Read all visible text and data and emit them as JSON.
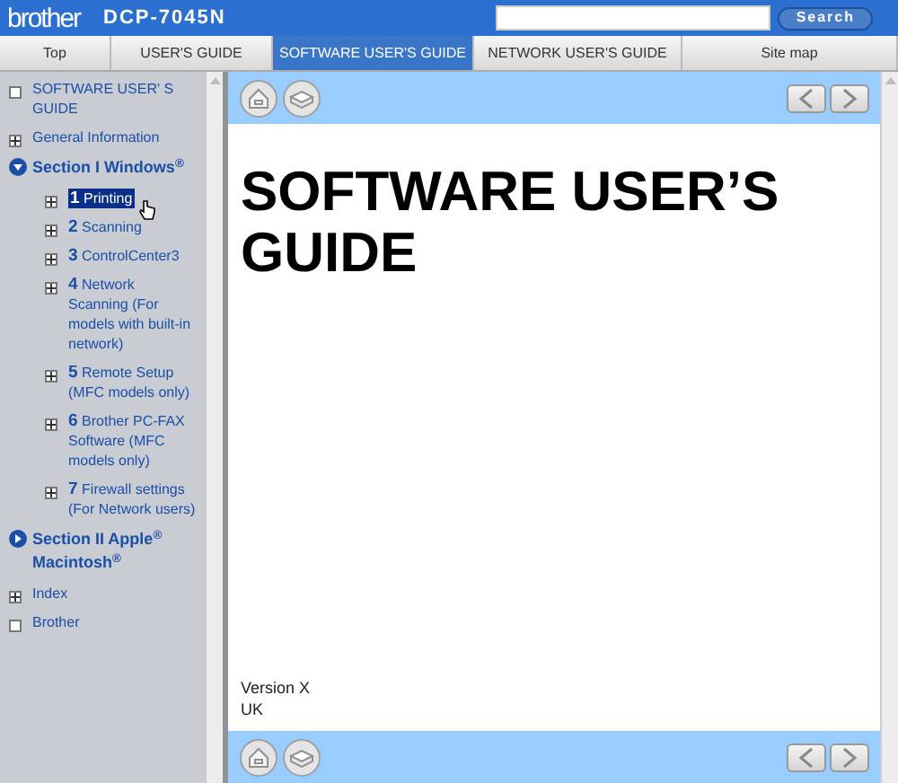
{
  "header": {
    "brand": "brother",
    "model": "DCP-7045N",
    "search_button": "Search"
  },
  "tabs": [
    {
      "label": "Top",
      "selected": false
    },
    {
      "label": "USER'S GUIDE",
      "selected": false
    },
    {
      "label": "SOFTWARE USER'S GUIDE",
      "selected": true
    },
    {
      "label": "NETWORK USER'S GUIDE",
      "selected": false
    },
    {
      "label": "Site map",
      "selected": false
    }
  ],
  "sidebar": {
    "items": [
      {
        "kind": "page",
        "label": "SOFTWARE USER' S GUIDE"
      },
      {
        "kind": "collapsed",
        "label": "General Information"
      },
      {
        "kind": "section",
        "expanded": true,
        "label": "Section I Windows$^{®}$",
        "children": [
          {
            "number": "1",
            "label": "Printing",
            "selected": true
          },
          {
            "number": "2",
            "label": "Scanning",
            "selected": false
          },
          {
            "number": "3",
            "label": "ControlCenter3",
            "selected": false
          },
          {
            "number": "4",
            "label": "Network Scanning (For models with built-in network)",
            "selected": false
          },
          {
            "number": "5",
            "label": "Remote Setup (MFC models only)",
            "selected": false
          },
          {
            "number": "6",
            "label": "Brother PC-FAX Software (MFC models only)",
            "selected": false
          },
          {
            "number": "7",
            "label": "Firewall settings (For Network users)",
            "selected": false
          }
        ]
      },
      {
        "kind": "section",
        "expanded": false,
        "label": "Section II Apple$^{®}$ Macintosh$^{®}$"
      },
      {
        "kind": "collapsed",
        "label": "Index"
      },
      {
        "kind": "page",
        "label": "Brother"
      }
    ]
  },
  "content": {
    "title": "SOFTWARE USER’S GUIDE",
    "footer_lines": [
      "Version X",
      "UK"
    ]
  }
}
